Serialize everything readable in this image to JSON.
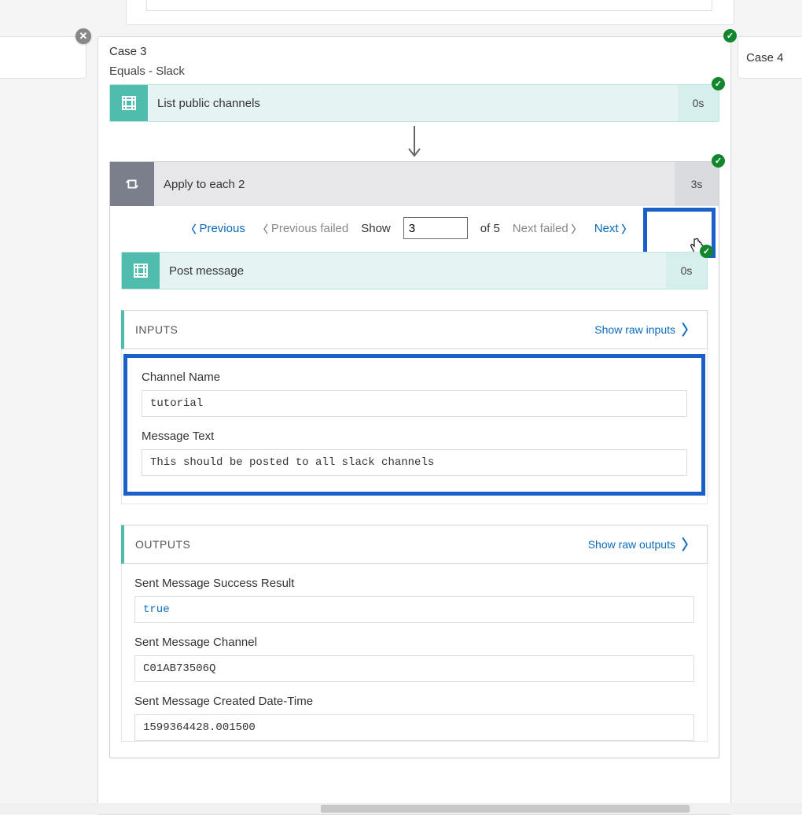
{
  "topCase": {
    "sibling": "Case 4"
  },
  "case": {
    "title": "Case 3",
    "subtitle": "Equals - Slack"
  },
  "step1": {
    "name": "List public channels",
    "time": "0s"
  },
  "foreach": {
    "name": "Apply to each 2",
    "time": "3s"
  },
  "pager": {
    "previous": "Previous",
    "previousFailed": "Previous failed",
    "showLabel": "Show",
    "showValue": "3",
    "ofLabel": "of 5",
    "nextFailed": "Next failed",
    "next": "Next"
  },
  "postMessage": {
    "name": "Post message",
    "time": "0s"
  },
  "inputs": {
    "heading": "INPUTS",
    "rawLink": "Show raw inputs",
    "fields": {
      "channelName": {
        "label": "Channel Name",
        "value": "tutorial"
      },
      "messageText": {
        "label": "Message Text",
        "value": "This should be posted to all slack channels"
      }
    }
  },
  "outputs": {
    "heading": "OUTPUTS",
    "rawLink": "Show raw outputs",
    "fields": {
      "success": {
        "label": "Sent Message Success Result",
        "value": "true"
      },
      "channel": {
        "label": "Sent Message Channel",
        "value": "C01AB73506Q"
      },
      "createdDt": {
        "label": "Sent Message Created Date-Time",
        "value": "1599364428.001500"
      }
    }
  }
}
